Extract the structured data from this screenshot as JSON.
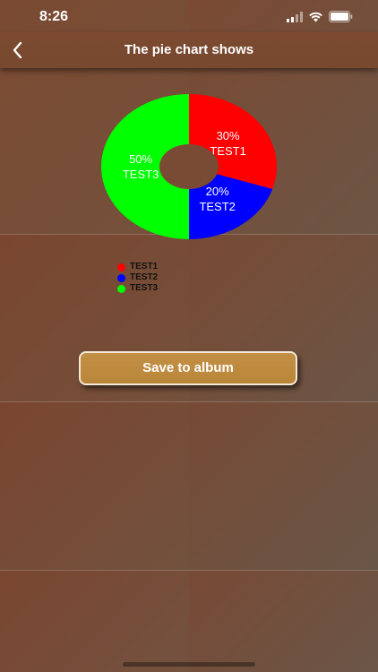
{
  "status_bar": {
    "time": "8:26"
  },
  "nav": {
    "title": "The pie chart shows"
  },
  "chart_data": {
    "type": "pie",
    "slices": [
      {
        "label": "TEST1",
        "percent_label": "30%",
        "value": 30,
        "color": "#ff0000"
      },
      {
        "label": "TEST2",
        "percent_label": "20%",
        "value": 20,
        "color": "#0000ff"
      },
      {
        "label": "TEST3",
        "percent_label": "50%",
        "value": 50,
        "color": "#00ff00"
      }
    ],
    "hole": true,
    "legend": [
      "TEST1",
      "TEST2",
      "TEST3"
    ],
    "legend_position": "bottom-left"
  },
  "actions": {
    "save_label": "Save to album"
  },
  "colors": {
    "button": "#c08c43",
    "button_border": "#f3ead8",
    "background": "#74503b"
  }
}
